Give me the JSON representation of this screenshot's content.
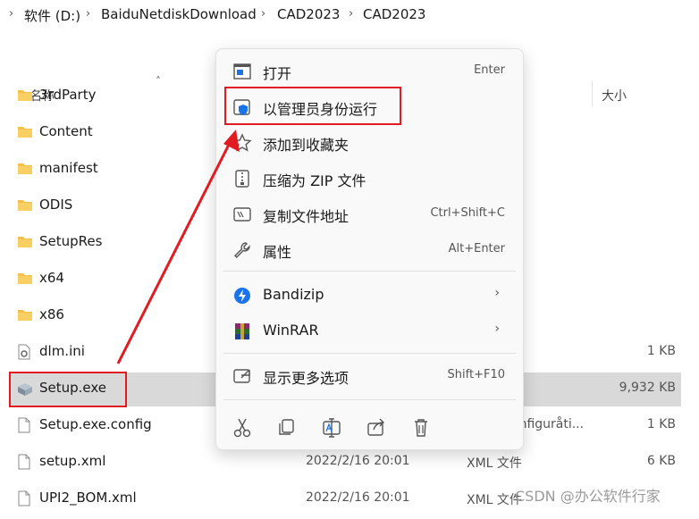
{
  "breadcrumb": {
    "items": [
      "软件 (D:)",
      "BaiduNetdiskDownload",
      "CAD2023",
      "CAD2023"
    ]
  },
  "columns": {
    "name": "名称",
    "size": "大小"
  },
  "files": [
    {
      "name": "3rdParty",
      "kind": "folder",
      "date": "",
      "type": "",
      "size": ""
    },
    {
      "name": "Content",
      "kind": "folder",
      "date": "",
      "type": "",
      "size": ""
    },
    {
      "name": "manifest",
      "kind": "folder",
      "date": "",
      "type": "",
      "size": ""
    },
    {
      "name": "ODIS",
      "kind": "folder",
      "date": "",
      "type": "",
      "size": ""
    },
    {
      "name": "SetupRes",
      "kind": "folder",
      "date": "",
      "type": "",
      "size": ""
    },
    {
      "name": "x64",
      "kind": "folder",
      "date": "",
      "type": "",
      "size": ""
    },
    {
      "name": "x86",
      "kind": "folder",
      "date": "",
      "type": "",
      "size": ""
    },
    {
      "name": "dlm.ini",
      "kind": "ini",
      "date": "",
      "type": "",
      "size": "1 KB"
    },
    {
      "name": "Setup.exe",
      "kind": "exe",
      "date": "",
      "type": "",
      "size": "9,932 KB"
    },
    {
      "name": "Setup.exe.config",
      "kind": "file",
      "date": "",
      "type": "onfiguråti...",
      "size": "1 KB"
    },
    {
      "name": "setup.xml",
      "kind": "file",
      "date": "2022/2/16 20:01",
      "type": "XML 文件",
      "size": "6 KB"
    },
    {
      "name": "UPI2_BOM.xml",
      "kind": "file",
      "date": "2022/2/16 20:01",
      "type": "XML 文件",
      "size": ""
    }
  ],
  "context_menu": {
    "items": [
      {
        "label": "打开",
        "shortcut": "Enter",
        "icon": "open-icon"
      },
      {
        "label": "以管理员身份运行",
        "shortcut": "",
        "icon": "admin-shield-icon"
      },
      {
        "label": "添加到收藏夹",
        "shortcut": "",
        "icon": "star-icon"
      },
      {
        "label": "压缩为 ZIP 文件",
        "shortcut": "",
        "icon": "zip-icon"
      },
      {
        "label": "复制文件地址",
        "shortcut": "Ctrl+Shift+C",
        "icon": "copy-path-icon"
      },
      {
        "label": "属性",
        "shortcut": "Alt+Enter",
        "icon": "wrench-icon"
      },
      {
        "label": "Bandizip",
        "shortcut": "",
        "icon": "bandizip-icon"
      },
      {
        "label": "WinRAR",
        "shortcut": "",
        "icon": "winrar-icon"
      },
      {
        "label": "显示更多选项",
        "shortcut": "Shift+F10",
        "icon": "more-options-icon"
      }
    ],
    "quick_actions": [
      "cut-icon",
      "copy-icon",
      "rename-icon",
      "share-icon",
      "delete-icon"
    ]
  },
  "watermark": "CSDN @办公软件行家",
  "colors": {
    "accent": "#e11b22",
    "selection": "#d9d9d9",
    "folder": "#f5c04a",
    "shield": "#1a73e8"
  }
}
